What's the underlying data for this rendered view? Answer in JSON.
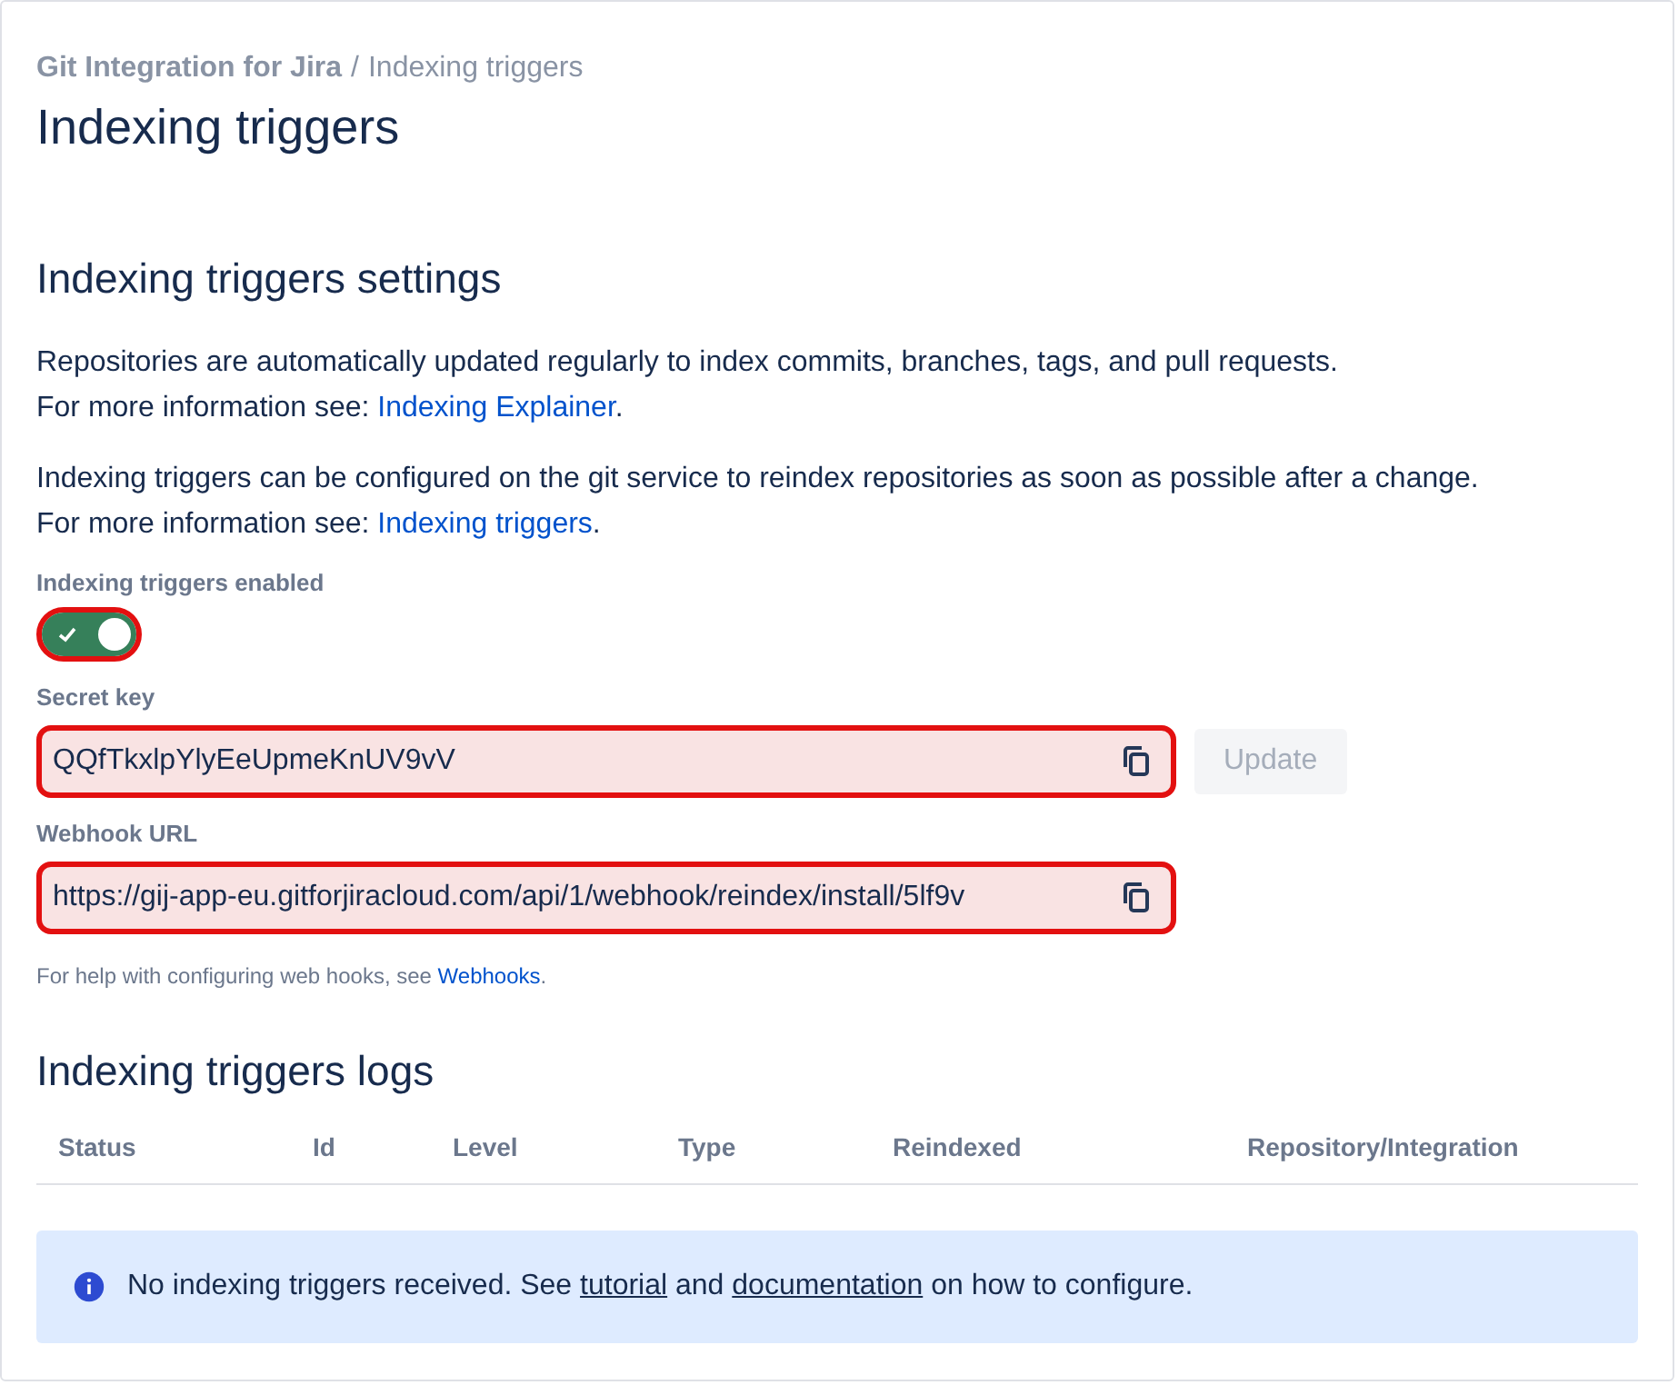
{
  "breadcrumb": {
    "parent": "Git Integration for Jira",
    "separator": "/",
    "current": "Indexing triggers"
  },
  "title": "Indexing triggers",
  "settings": {
    "heading": "Indexing triggers settings",
    "paragraphs": [
      [
        {
          "text": "Repositories are automatically updated regularly to index commits, branches, tags, and pull requests."
        },
        {
          "text": "For more information see: ",
          "link": "Indexing Explainer",
          "after": "."
        }
      ],
      [
        {
          "text": "Indexing triggers can be configured on the git service to reindex repositories as soon as possible after a change."
        },
        {
          "text": "For more information see: ",
          "link": "Indexing triggers",
          "after": "."
        }
      ]
    ],
    "toggle": {
      "label": "Indexing triggers enabled",
      "on": true,
      "highlighted": true
    },
    "secret_key": {
      "label": "Secret key",
      "value": "QQfTkxlpYlyEeUpmeKnUV9vV",
      "highlighted": true,
      "button": {
        "label": "Update",
        "disabled": true
      }
    },
    "webhook_url": {
      "label": "Webhook URL",
      "value": "https://gij-app-eu.gitforjiracloud.com/api/1/webhook/reindex/install/5lf9v",
      "highlighted": true
    },
    "help": {
      "text": "For help with configuring web hooks, see ",
      "link": "Webhooks",
      "after": "."
    }
  },
  "logs": {
    "heading": "Indexing triggers logs",
    "columns": [
      "Status",
      "Id",
      "Level",
      "Type",
      "Reindexed",
      "Repository/Integration"
    ],
    "message": [
      {
        "kind": "text",
        "text": "No indexing triggers received. See "
      },
      {
        "kind": "link",
        "text": "tutorial"
      },
      {
        "kind": "text",
        "text": " and "
      },
      {
        "kind": "link",
        "text": "documentation"
      },
      {
        "kind": "text",
        "text": " on how to configure."
      }
    ]
  }
}
